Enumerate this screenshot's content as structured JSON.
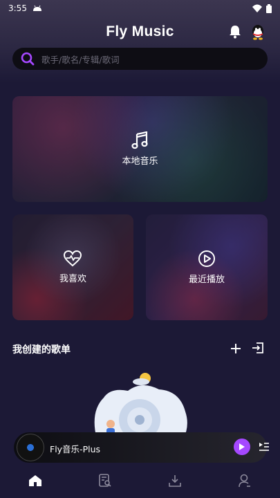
{
  "status": {
    "time": "3:55"
  },
  "header": {
    "title": "Fly Music"
  },
  "search": {
    "placeholder": "歌手/歌名/专辑/歌词"
  },
  "cards": {
    "local": "本地音乐",
    "favorites": "我喜欢",
    "recent": "最近播放"
  },
  "playlists": {
    "title": "我创建的歌单"
  },
  "player": {
    "song": "Fly音乐-Plus"
  },
  "colors": {
    "accent": "#a548ff",
    "background": "#1c1936"
  },
  "nav": {
    "items": [
      "home-icon",
      "playlist-search-icon",
      "download-icon",
      "profile-icon"
    ],
    "active": "home-icon"
  }
}
